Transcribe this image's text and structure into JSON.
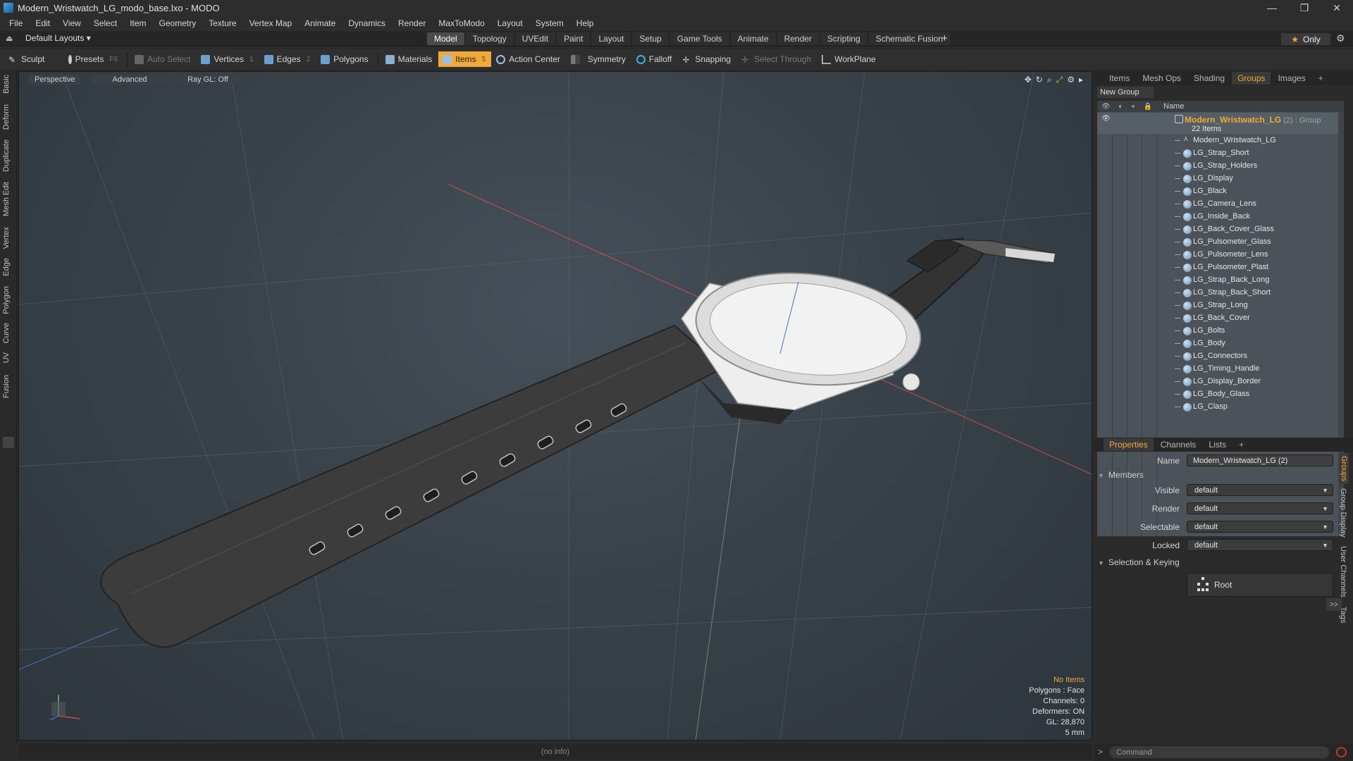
{
  "window": {
    "title": "Modern_Wristwatch_LG_modo_base.lxo - MODO",
    "minimize": "—",
    "restore": "❐",
    "close": "✕"
  },
  "menu": [
    "File",
    "Edit",
    "View",
    "Select",
    "Item",
    "Geometry",
    "Texture",
    "Vertex Map",
    "Animate",
    "Dynamics",
    "Render",
    "MaxToModo",
    "Layout",
    "System",
    "Help"
  ],
  "layoutbar": {
    "layout_select": "Default Layouts ▾",
    "tabs": [
      "Model",
      "Topology",
      "UVEdit",
      "Paint",
      "Layout",
      "Setup",
      "Game Tools",
      "Animate",
      "Render",
      "Scripting",
      "Schematic Fusion"
    ],
    "active_tab": "Model",
    "only_label": "Only"
  },
  "toolbar": {
    "sculpt": "Sculpt",
    "presets": "Presets",
    "presets_key": "F6",
    "auto_select": "Auto Select",
    "vertices": "Vertices",
    "vertices_key": "1",
    "edges": "Edges",
    "edges_key": "2",
    "polygons": "Polygons",
    "materials": "Materials",
    "items": "Items",
    "items_key": "5",
    "action_center": "Action Center",
    "symmetry": "Symmetry",
    "falloff": "Falloff",
    "snapping": "Snapping",
    "select_through": "Select Through",
    "workplane": "WorkPlane"
  },
  "left_tabs": [
    "Basic",
    "Deform",
    "Duplicate",
    "Mesh Edit",
    "Vertex",
    "Edge",
    "Polygon",
    "Curve",
    "UV",
    "Fusion"
  ],
  "viewport": {
    "perspective": "Perspective",
    "advanced": "Advanced",
    "raygl": "Ray GL: Off",
    "info": {
      "no_items": "No Items",
      "polygons": "Polygons : Face",
      "channels": "Channels: 0",
      "deformers": "Deformers: ON",
      "gl": "GL: 28,870",
      "scale": "5 mm"
    }
  },
  "status": "(no info)",
  "right_tabs": [
    "Items",
    "Mesh Ops",
    "Shading",
    "Groups",
    "Images"
  ],
  "right_active_tab": "Groups",
  "groups": {
    "new_group": "New Group",
    "name_header": "Name",
    "group_name": "Modern_Wristwatch_LG",
    "group_meta": " (2) : Group",
    "group_count": "22 Items",
    "members": [
      "Modern_Wristwatch_LG",
      "LG_Strap_Short",
      "LG_Strap_Holders",
      "LG_Display",
      "LG_Black",
      "LG_Camera_Lens",
      "LG_Inside_Back",
      "LG_Back_Cover_Glass",
      "LG_Pulsometer_Glass",
      "LG_Pulsometer_Lens",
      "LG_Pulsometer_Plast",
      "LG_Strap_Back_Long",
      "LG_Strap_Back_Short",
      "LG_Strap_Long",
      "LG_Back_Cover",
      "LG_Bolts",
      "LG_Body",
      "LG_Connectors",
      "LG_Timing_Handle",
      "LG_Display_Border",
      "LG_Body_Glass",
      "LG_Clasp"
    ]
  },
  "props_tabs": [
    "Properties",
    "Channels",
    "Lists"
  ],
  "props_active_tab": "Properties",
  "properties": {
    "name_label": "Name",
    "name_value": "Modern_Wristwatch_LG (2)",
    "members_section": "Members",
    "visible_label": "Visible",
    "visible_value": "default",
    "render_label": "Render",
    "render_value": "default",
    "selectable_label": "Selectable",
    "selectable_value": "default",
    "locked_label": "Locked",
    "locked_value": "default",
    "selection_section": "Selection & Keying",
    "root_label": "Root",
    "more": ">>"
  },
  "props_side_tabs": [
    "Groups",
    "Group Display",
    "User Channels",
    "Tags"
  ],
  "command_placeholder": "Command",
  "colors": {
    "accent": "#f2a93b",
    "viewport_bg": "#39424a"
  }
}
